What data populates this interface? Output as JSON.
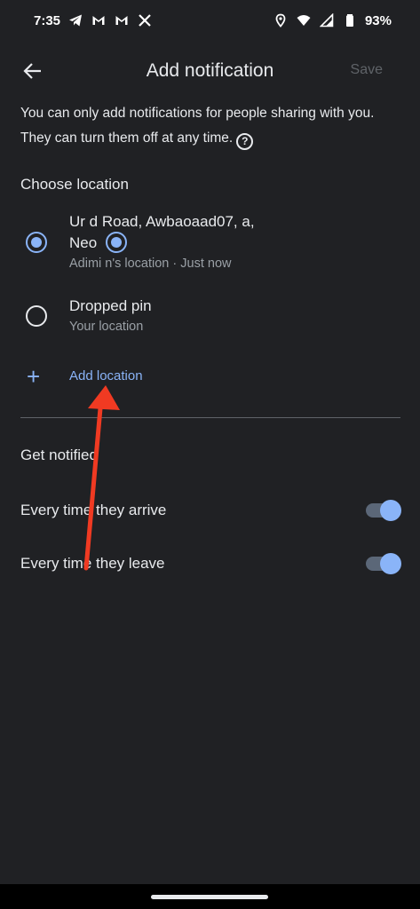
{
  "status_bar": {
    "time": "7:35",
    "left_icons": [
      "telegram-icon",
      "gmail-icon",
      "gmail-icon",
      "x-icon"
    ],
    "right_icons": [
      "location-icon",
      "wifi-icon",
      "signal-icon",
      "battery-icon"
    ],
    "battery": "93%"
  },
  "app_bar": {
    "title": "Add notification",
    "save_label": "Save"
  },
  "intro_text": "You can only add notifications for people sharing with you. They can turn them off at any time.",
  "choose_location": {
    "heading": "Choose location",
    "items": [
      {
        "title_line1": "Ur      d Road, Awbaoaad07,              a,",
        "title_line2": "Neo",
        "subtitle": "Adimi    n's location · Just now",
        "selected": true
      },
      {
        "title_line1": "Dropped pin",
        "subtitle": "Your location",
        "selected": false
      }
    ],
    "add_label": "Add location"
  },
  "get_notified": {
    "heading": "Get notified",
    "toggles": [
      {
        "label": "Every time they arrive",
        "on": true
      },
      {
        "label": "Every time they leave",
        "on": true
      }
    ]
  },
  "colors": {
    "background": "#202124",
    "accent": "#8ab4f8",
    "annotation_arrow": "#f03a22"
  }
}
